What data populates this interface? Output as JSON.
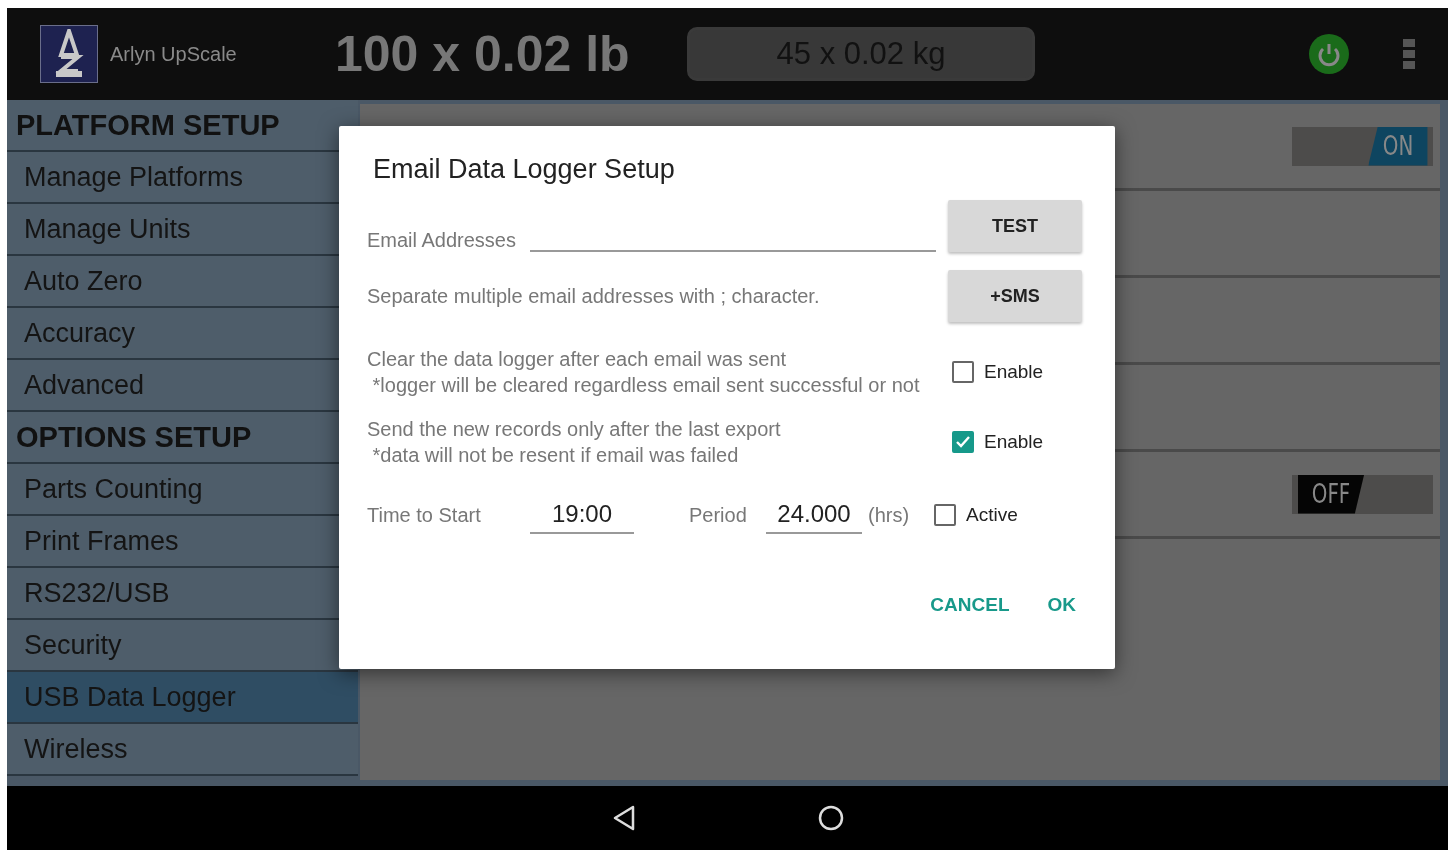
{
  "app_bar": {
    "title": "Arlyn UpScale",
    "primary_capacity": "100 x 0.02 lb",
    "secondary_capacity": "45 x 0.02 kg"
  },
  "sidebar": {
    "sections": [
      {
        "title": "PLATFORM SETUP",
        "items": [
          {
            "label": "Manage Platforms",
            "selected": false
          },
          {
            "label": "Manage Units",
            "selected": false
          },
          {
            "label": "Auto Zero",
            "selected": false
          },
          {
            "label": "Accuracy",
            "selected": false
          },
          {
            "label": "Advanced",
            "selected": false
          }
        ]
      },
      {
        "title": "OPTIONS SETUP",
        "items": [
          {
            "label": "Parts Counting",
            "selected": false
          },
          {
            "label": "Print Frames",
            "selected": false
          },
          {
            "label": "RS232/USB",
            "selected": false
          },
          {
            "label": "Security",
            "selected": false
          },
          {
            "label": "USB Data Logger",
            "selected": true
          },
          {
            "label": "Wireless",
            "selected": false
          }
        ]
      }
    ]
  },
  "content": {
    "rows": [
      {
        "kind": "toggle",
        "on": true,
        "label": "ON"
      },
      {
        "kind": "empty"
      },
      {
        "kind": "empty"
      },
      {
        "kind": "empty"
      },
      {
        "kind": "toggle",
        "on": false,
        "label": "OFF"
      }
    ]
  },
  "dialog": {
    "title": "Email Data Logger Setup",
    "email_label": "Email Addresses",
    "test_button": "TEST",
    "hint": "Separate multiple email addresses with ; character.",
    "sms_button": "+SMS",
    "options": [
      {
        "text": "Clear the data logger after each email was sent",
        "note": "*logger will be cleared regardless email sent successful or not",
        "checkbox_label": "Enable",
        "checked": false
      },
      {
        "text": "Send the new records only after the last export",
        "note": "*data will not be resent if email was failed",
        "checkbox_label": "Enable",
        "checked": true
      }
    ],
    "schedule": {
      "time_label": "Time to Start",
      "time_value": "19:00",
      "period_label": "Period",
      "period_value": "24.000",
      "period_unit": "(hrs)",
      "active_label": "Active",
      "active": false
    },
    "actions": [
      "CANCEL",
      "OK"
    ]
  }
}
